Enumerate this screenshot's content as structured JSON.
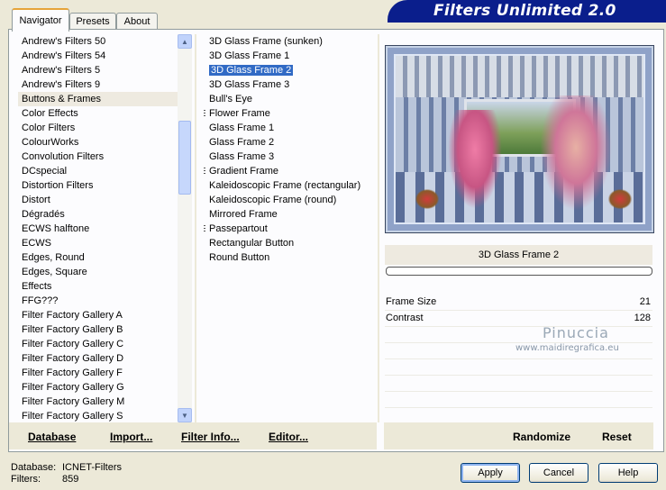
{
  "app": {
    "title": "Filters Unlimited 2.0"
  },
  "tabs": [
    {
      "label": "Navigator"
    },
    {
      "label": "Presets"
    },
    {
      "label": "About"
    }
  ],
  "categories": [
    "Andrew's Filters 50",
    "Andrew's Filters 54",
    "Andrew's Filters 5",
    "Andrew's Filters 9",
    "Buttons & Frames",
    "Color Effects",
    "Color Filters",
    "ColourWorks",
    "Convolution Filters",
    "DCspecial",
    "Distortion Filters",
    "Distort",
    "Dégradés",
    "ECWS halftone",
    "ECWS",
    "Edges, Round",
    "Edges, Square",
    "Effects",
    "FFG???",
    "Filter Factory Gallery A",
    "Filter Factory Gallery B",
    "Filter Factory Gallery C",
    "Filter Factory Gallery D",
    "Filter Factory Gallery F",
    "Filter Factory Gallery G",
    "Filter Factory Gallery M",
    "Filter Factory Gallery S"
  ],
  "selected_category": "Buttons & Frames",
  "filters": [
    {
      "label": "3D Glass Frame (sunken)",
      "group": false
    },
    {
      "label": "3D Glass Frame 1",
      "group": false
    },
    {
      "label": "3D Glass Frame 2",
      "group": false
    },
    {
      "label": "3D Glass Frame 3",
      "group": false
    },
    {
      "label": "Bull's Eye",
      "group": false
    },
    {
      "label": "Flower Frame",
      "group": true
    },
    {
      "label": "Glass Frame 1",
      "group": false
    },
    {
      "label": "Glass Frame 2",
      "group": false
    },
    {
      "label": "Glass Frame 3",
      "group": false
    },
    {
      "label": "Gradient Frame",
      "group": true
    },
    {
      "label": "Kaleidoscopic Frame (rectangular)",
      "group": false
    },
    {
      "label": "Kaleidoscopic Frame (round)",
      "group": false
    },
    {
      "label": "Mirrored Frame",
      "group": false
    },
    {
      "label": "Passepartout",
      "group": true
    },
    {
      "label": "Rectangular Button",
      "group": false
    },
    {
      "label": "Round Button",
      "group": false
    }
  ],
  "selected_filter": "3D Glass Frame 2",
  "filter_name": "3D Glass Frame 2",
  "params": [
    {
      "label": "Frame Size",
      "value": "21"
    },
    {
      "label": "Contrast",
      "value": "128"
    }
  ],
  "watermark": {
    "name": "Pinuccia",
    "url": "www.maidiregrafica.eu"
  },
  "toolbar": {
    "database": "Database",
    "import": "Import...",
    "filter_info": "Filter Info...",
    "editor": "Editor...",
    "randomize": "Randomize",
    "reset": "Reset"
  },
  "footer": {
    "database_label": "Database:",
    "database_value": "ICNET-Filters",
    "filters_label": "Filters:",
    "filters_value": "859"
  },
  "buttons": {
    "apply": "Apply",
    "cancel": "Cancel",
    "help": "Help"
  },
  "colors": {
    "accent": "#316ac5",
    "banner": "#0a1e8c",
    "background": "#ece9d8"
  }
}
